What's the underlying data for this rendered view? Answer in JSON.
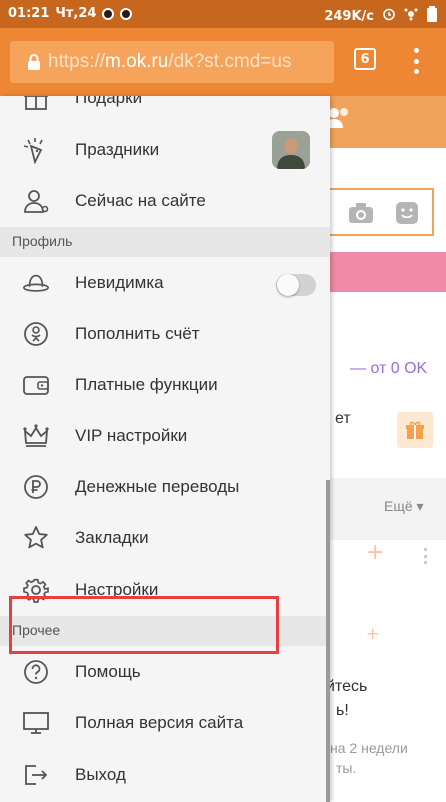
{
  "status_bar": {
    "time": "01:21",
    "day": "Чт,24",
    "speed": "249K/c"
  },
  "browser": {
    "url_host": "m.ok.ru",
    "url_scheme": "https://",
    "url_rest": "/dk?st.cmd=us",
    "tab_count": "6"
  },
  "drawer": {
    "items_top": [
      {
        "label": "Подарки",
        "icon": "gift-icon"
      },
      {
        "label": "Праздники",
        "icon": "party-icon"
      },
      {
        "label": "Сейчас на сайте",
        "icon": "person-icon"
      }
    ],
    "section_profile": "Профиль",
    "items_profile": [
      {
        "label": "Невидимка",
        "icon": "hat-icon"
      },
      {
        "label": "Пополнить счёт",
        "icon": "ok-logo-icon"
      },
      {
        "label": "Платные функции",
        "icon": "wallet-icon"
      },
      {
        "label": "VIP настройки",
        "icon": "crown-icon"
      },
      {
        "label": "Денежные переводы",
        "icon": "ruble-icon"
      },
      {
        "label": "Закладки",
        "icon": "star-icon"
      },
      {
        "label": "Настройки",
        "icon": "gear-icon"
      }
    ],
    "section_other": "Прочее",
    "items_other": [
      {
        "label": "Помощь",
        "icon": "help-icon"
      },
      {
        "label": "Полная версия сайта",
        "icon": "monitor-icon"
      },
      {
        "label": "Выход",
        "icon": "logout-icon"
      }
    ],
    "invisible_toggle_on": false
  },
  "background_page": {
    "price_text": "— от 0 OK",
    "fragment_et": "ет",
    "more_label": "Ещё",
    "frag_line1": "уйтесь",
    "frag_line2": "ь!",
    "frag_line3": "на 2 недели",
    "frag_line4": "ты."
  },
  "colors": {
    "accent": "#ee8733",
    "highlight_border": "#e5403e"
  }
}
